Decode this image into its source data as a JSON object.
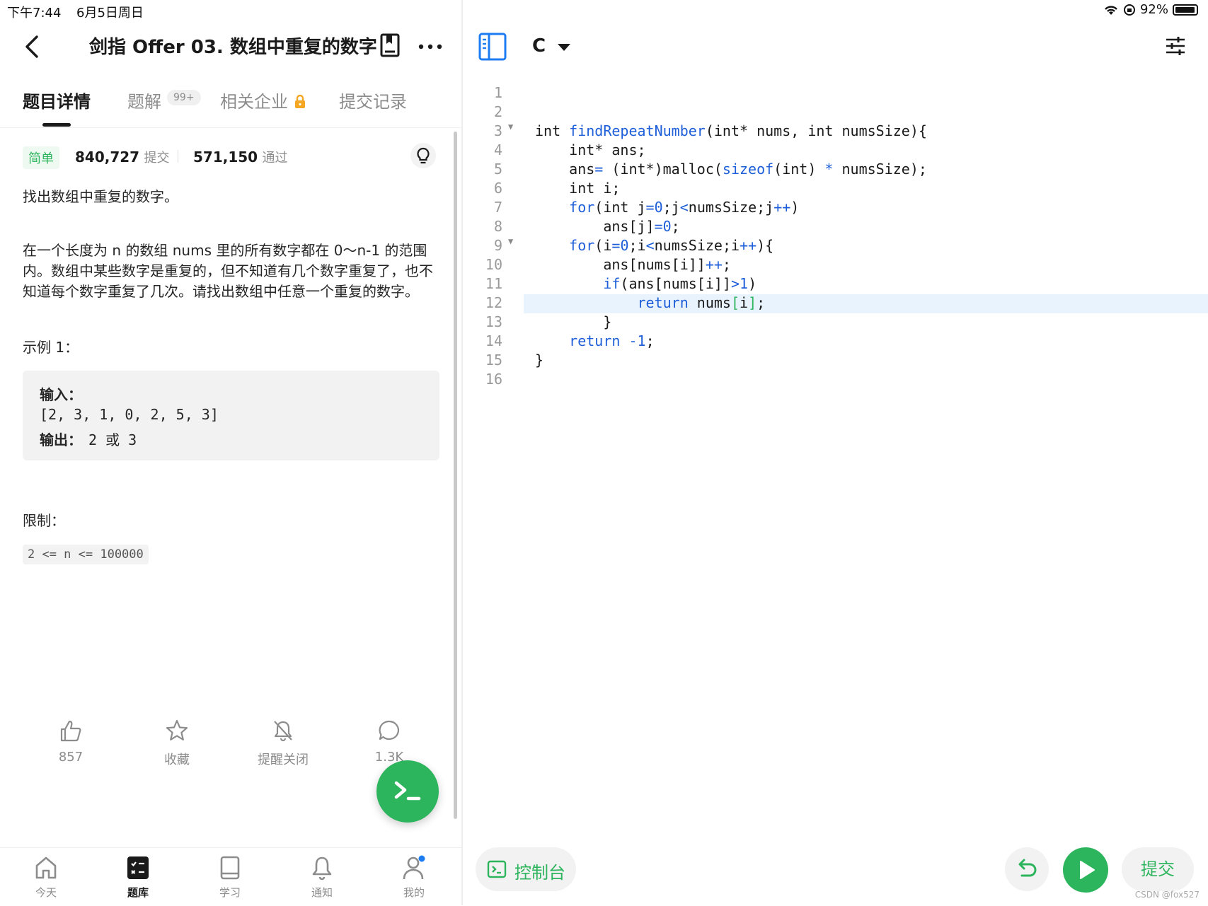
{
  "status_bar": {
    "time": "下午7:44",
    "date": "6月5日周日",
    "battery": "92%"
  },
  "header": {
    "title": "剑指 Offer 03. 数组中重复的数字"
  },
  "tabs": [
    {
      "label": "题目详情"
    },
    {
      "label": "题解",
      "badge": "99+"
    },
    {
      "label": "相关企业"
    },
    {
      "label": "提交记录"
    }
  ],
  "stats": {
    "difficulty": "简单",
    "submissions": "840,727",
    "submissions_unit": "提交",
    "passes": "571,150",
    "passes_unit": "通过"
  },
  "description": {
    "p1": "找出数组中重复的数字。",
    "p2": "在一个长度为 n 的数组 nums 里的所有数字都在 0～n-1 的范围内。数组中某些数字是重复的，但不知道有几个数字重复了，也不知道每个数字重复了几次。请找出数组中任意一个重复的数字。"
  },
  "example": {
    "title": "示例 1：",
    "input_label": "输入：",
    "input_value": "[2, 3, 1, 0, 2, 5, 3]",
    "output_label": "输出：",
    "output_value": "2 或 3"
  },
  "limits": {
    "title": "限制：",
    "code": "2 <= n <= 100000"
  },
  "actions": {
    "like": "857",
    "favorite": "收藏",
    "remind": "提醒关闭",
    "comments": "1.3K"
  },
  "bottom_nav": [
    "今天",
    "题库",
    "学习",
    "通知",
    "我的"
  ],
  "editor": {
    "language": "C",
    "line_numbers": [
      "1",
      "2",
      "3",
      "4",
      "5",
      "6",
      "7",
      "8",
      "9",
      "10",
      "11",
      "12",
      "13",
      "14",
      "15",
      "16"
    ],
    "highlighted_line": "12"
  },
  "footer": {
    "console": "控制台",
    "submit": "提交"
  },
  "watermark": "CSDN @fox527",
  "colors": {
    "accent": "#2db55d",
    "keyword": "#1e5fd9",
    "highlight": "#e8f3fd"
  }
}
